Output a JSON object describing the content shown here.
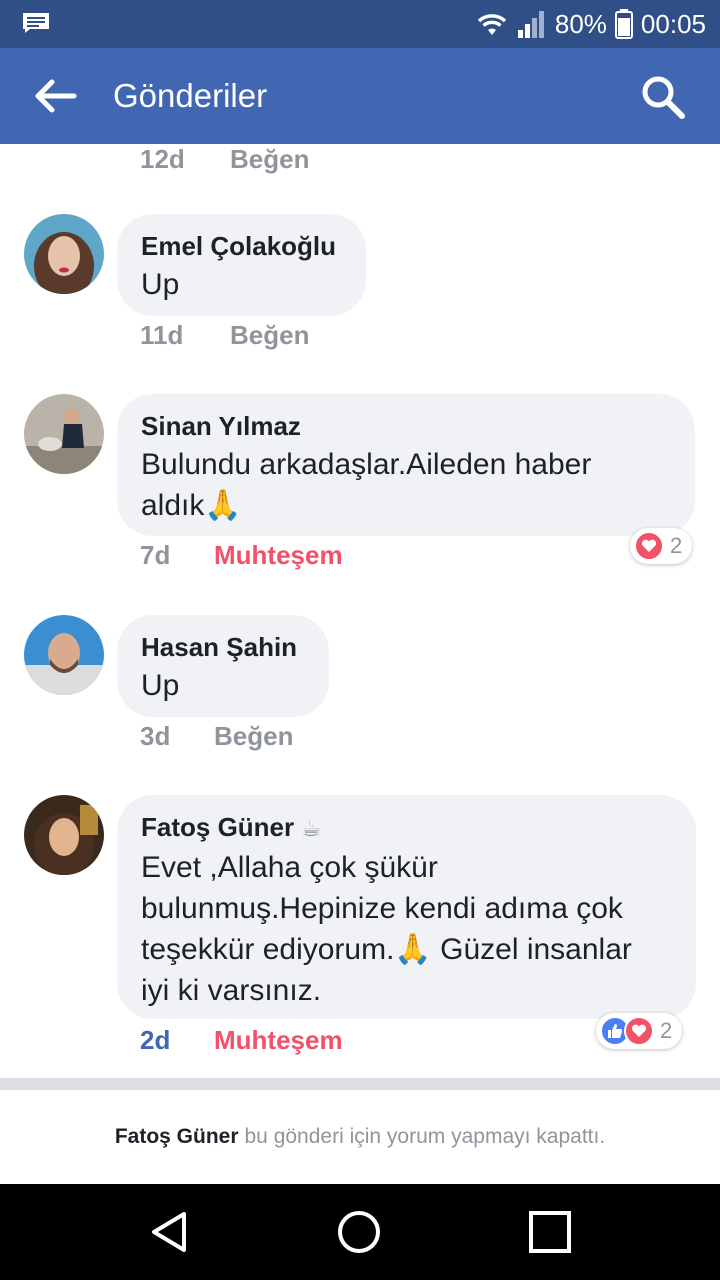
{
  "status_bar": {
    "battery": "80%",
    "time": "00:05"
  },
  "app_bar": {
    "title": "Gönderiler"
  },
  "top_partial": {
    "time": "12d",
    "action": "Beğen"
  },
  "comments": [
    {
      "name": "Emel Çolakoğlu",
      "text": "Up",
      "time": "11d",
      "action": "Beğen"
    },
    {
      "name": "Sinan Yılmaz",
      "text_line1": "Bulundu arkadaşlar.Aileden haber",
      "text_line2": "aldık🙏",
      "time": "7d",
      "action": "Muhteşem",
      "reaction_count": "2"
    },
    {
      "name": "Hasan Şahin",
      "text": "Up",
      "time": "3d",
      "action": "Beğen"
    },
    {
      "name": "Fatoş Güner",
      "name_emoji": "☕",
      "text_line1": "Evet ,Allaha çok şükür",
      "text_line2": "bulunmuş.Hepinize kendi adıma çok",
      "text_line3": "teşekkür ediyorum.🙏 Güzel insanlar",
      "text_line4": "iyi ki varsınız.",
      "time": "2d",
      "action": "Muhteşem",
      "reaction_count": "2"
    }
  ],
  "closed_note": {
    "name": "Fatoş Güner",
    "text": "bu gönderi için yorum yapmayı kapattı."
  },
  "colors": {
    "status_bar": "#2f4f86",
    "app_bar": "#4267b2",
    "bubble": "#f1f2f6",
    "love": "#f25268",
    "meta_gray": "#90949c"
  }
}
